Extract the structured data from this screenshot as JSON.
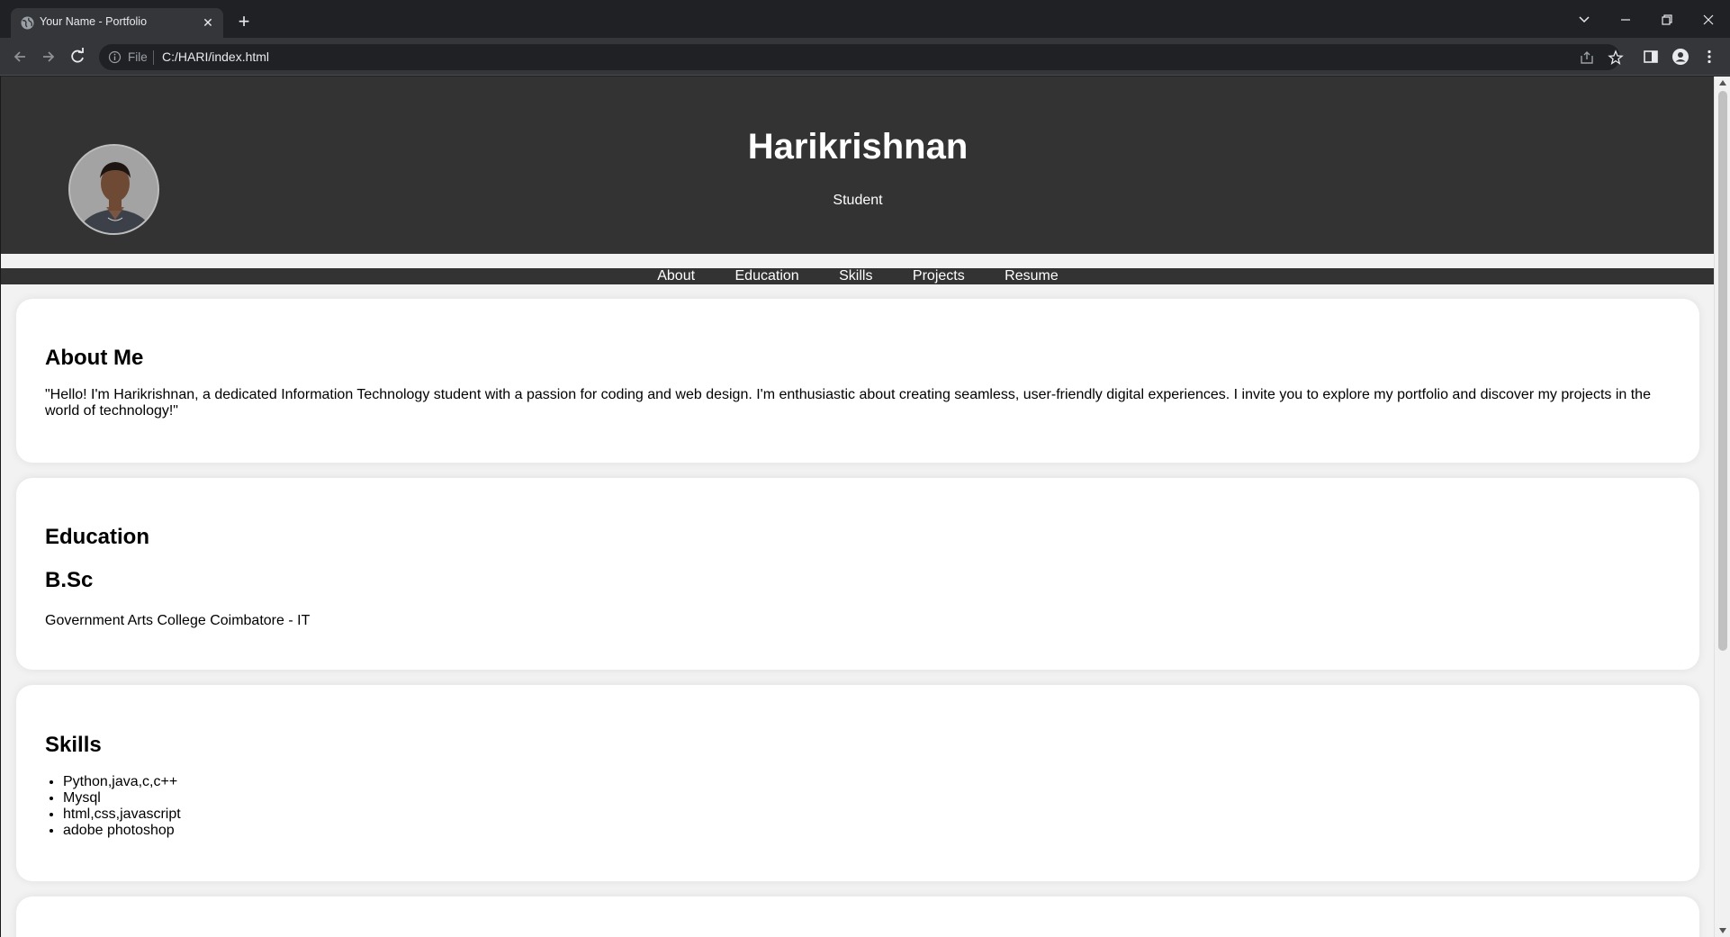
{
  "browser": {
    "tab_title": "Your Name - Portfolio",
    "file_label": "File",
    "url": "C:/HARI/index.html"
  },
  "header": {
    "name": "Harikrishnan",
    "role": "Student"
  },
  "nav": {
    "items": [
      "About",
      "Education",
      "Skills",
      "Projects",
      "Resume"
    ]
  },
  "about": {
    "title": "About Me",
    "text": "\"Hello! I'm Harikrishnan, a dedicated Information Technology student with a passion for coding and web design. I'm enthusiastic about creating seamless, user-friendly digital experiences. I invite you to explore my portfolio and discover my projects in the world of technology!\""
  },
  "education": {
    "title": "Education",
    "degree": "B.Sc",
    "institution": "Government Arts College Coimbatore - IT"
  },
  "skills": {
    "title": "Skills",
    "items": [
      "Python,java,c,c++",
      "Mysql",
      "html,css,javascript",
      "adobe photoshop"
    ]
  },
  "colors": {
    "header_bg": "#333333",
    "page_bg": "#f2f2f2",
    "card_bg": "#ffffff",
    "browser_bg": "#202124"
  }
}
